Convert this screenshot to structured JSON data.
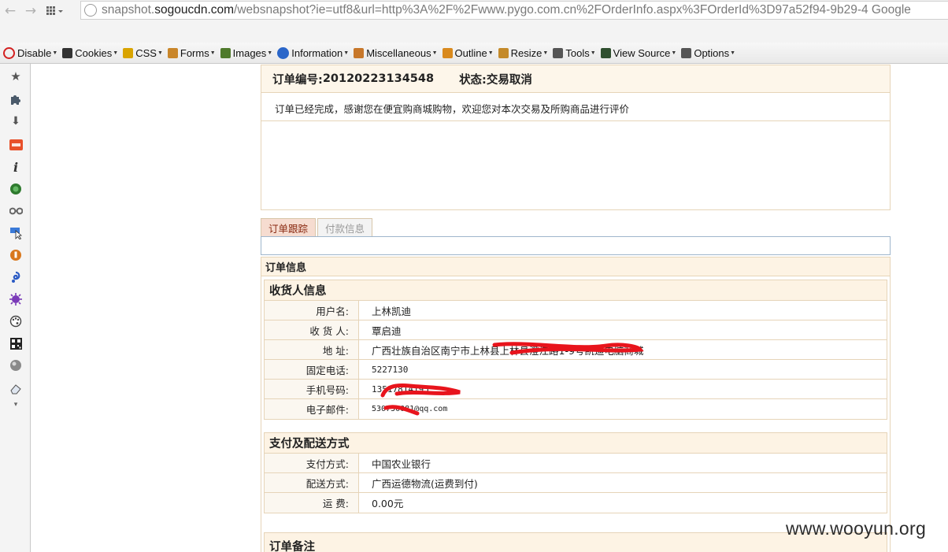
{
  "browser": {
    "back_glyph": "←",
    "forward_glyph": "→",
    "url_prefix": "snapshot.",
    "url_domain": "sogoucdn.com",
    "url_rest": "/websnapshot?ie=utf8&url=http%3A%2F%2Fwww.pygo.com.cn%2FOrderInfo.aspx%3FOrderId%3D97a52f94-9b29-4 Google"
  },
  "dev_toolbar": {
    "items": [
      {
        "label": "Disable",
        "icon": "disable-icon",
        "color": "#d32020"
      },
      {
        "label": "Cookies",
        "icon": "cookie-person-icon",
        "color": "#333333"
      },
      {
        "label": "CSS",
        "icon": "css-wand-icon",
        "color": "#d9a400"
      },
      {
        "label": "Forms",
        "icon": "forms-clipboard-icon",
        "color": "#c9862a"
      },
      {
        "label": "Images",
        "icon": "images-icon",
        "color": "#4f7a2c"
      },
      {
        "label": "Information",
        "icon": "info-icon",
        "color": "#2a66c9"
      },
      {
        "label": "Miscellaneous",
        "icon": "notebook-icon",
        "color": "#c7772a"
      },
      {
        "label": "Outline",
        "icon": "pencil-icon",
        "color": "#d98a1e"
      },
      {
        "label": "Resize",
        "icon": "resize-pencil-icon",
        "color": "#c48a2a"
      },
      {
        "label": "Tools",
        "icon": "tools-icon",
        "color": "#555555"
      },
      {
        "label": "View Source",
        "icon": "view-source-icon",
        "color": "#2f4f2f"
      },
      {
        "label": "Options",
        "icon": "options-icon",
        "color": "#555555"
      }
    ]
  },
  "sidebar": {
    "icons": [
      "star-icon",
      "puzzle-icon",
      "download-icon",
      "weibo-icon",
      "info-italic-icon",
      "shield-icon",
      "glasses-icon",
      "cursor-icon",
      "lastpass-icon",
      "swirl-icon",
      "virus-icon",
      "palette-icon",
      "qr-icon",
      "globe-icon",
      "eraser-icon",
      "more-chevron-icon"
    ],
    "star_glyph": "★",
    "download_glyph": "⬇",
    "info_glyph": "i",
    "more_glyph": "▾"
  },
  "order": {
    "number_label": "订单编号:",
    "number": "20120223134548",
    "status_label": "状态:",
    "status": "交易取消",
    "notice": "订单已经完成，感谢您在便宜购商城购物，欢迎您对本次交易及所购商品进行评价"
  },
  "tabs": [
    {
      "label": "订单跟踪",
      "active": true
    },
    {
      "label": "付款信息",
      "active": false
    }
  ],
  "order_info": {
    "title": "订单信息",
    "consignee": {
      "title": "收货人信息",
      "rows": [
        {
          "label": "用户名:",
          "value": "上林凯迪"
        },
        {
          "label": "收 货 人:",
          "value": "覃启迪"
        },
        {
          "label": "地 址:",
          "value": "广西壮族自治区南宁市上林县上林县澄江路1-9号凯迪电脑商城"
        },
        {
          "label": "固定电话:",
          "value": "5227130"
        },
        {
          "label": "手机号码:",
          "value": "13517814195"
        },
        {
          "label": "电子邮件:",
          "value": "530750081@qq.com"
        }
      ]
    },
    "payment": {
      "title": "支付及配送方式",
      "rows": [
        {
          "label": "支付方式:",
          "value": "中国农业银行"
        },
        {
          "label": "配送方式:",
          "value": "广西运德物流(运费到付)"
        },
        {
          "label": "运 费:",
          "value": "0.00元"
        }
      ]
    },
    "remark_title": "订单备注"
  },
  "watermark": "www.wooyun.org",
  "colors": {
    "border": "#e6d4b8",
    "header_bg": "#fdf3e4",
    "redaction": "#e8141c",
    "tab_active_bg": "#f6dcd0"
  }
}
